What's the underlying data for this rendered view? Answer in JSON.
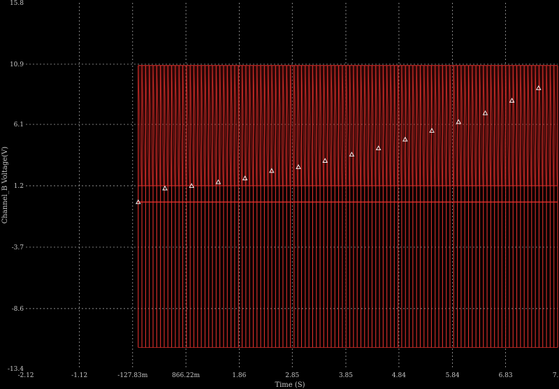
{
  "colors": {
    "background": "#000000",
    "grid": "#bfbfbf",
    "trace": "#e0302c",
    "trace_dark": "#7a1512",
    "marker": "#ffffff",
    "text": "#c8c8c8"
  },
  "chart_data": {
    "type": "line",
    "xlabel": "Time (S)",
    "ylabel": "Channel_B Voltage(V)",
    "xlim": [
      -2.12,
      7.8
    ],
    "ylim": [
      -13.4,
      15.8
    ],
    "grid": true,
    "x_tick_labels": [
      "-2.12",
      "-1.12",
      "-127.83m",
      "866.22m",
      "1.86",
      "2.85",
      "3.85",
      "4.84",
      "5.84",
      "6.83",
      "7.8"
    ],
    "x_tick_values": [
      -2.12,
      -1.12,
      -0.12783,
      0.86622,
      1.86,
      2.85,
      3.85,
      4.84,
      5.84,
      6.83,
      7.8
    ],
    "y_tick_labels": [
      "15.8",
      "10.9",
      "6.1",
      "1.2",
      "-3.7",
      "-8.6",
      "-13.4"
    ],
    "y_tick_values": [
      15.8,
      10.9,
      6.1,
      1.2,
      -3.7,
      -8.6,
      -13.4
    ],
    "series": [
      {
        "style": "pulse-envelope",
        "x_start": -0.0239,
        "x_end": 7.8,
        "high": 10.8,
        "low": -11.7,
        "band_low": 1.2,
        "pulse_count": 113,
        "mid_level": -0.1
      },
      {
        "style": "markers",
        "marker": "triangle",
        "x": [
          -0.0239,
          0.474,
          0.972,
          1.47,
          1.968,
          2.466,
          2.964,
          3.462,
          3.96,
          4.458,
          4.956,
          5.454,
          5.952,
          6.45,
          6.948,
          7.446
        ],
        "y": [
          -0.1,
          1.0,
          1.2,
          1.5,
          1.8,
          2.4,
          2.7,
          3.2,
          3.7,
          4.2,
          4.9,
          5.6,
          6.3,
          7.0,
          8.0,
          9.0
        ]
      }
    ]
  }
}
